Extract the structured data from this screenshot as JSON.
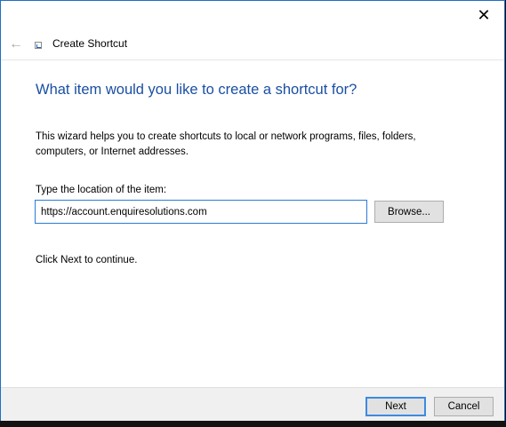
{
  "titlebar": {
    "close_glyph": "✕"
  },
  "nav": {
    "back_glyph": "←",
    "title": "Create Shortcut",
    "icon": "shortcut-wizard-icon"
  },
  "content": {
    "heading": "What item would you like to create a shortcut for?",
    "description": "This wizard helps you to create shortcuts to local or network programs, files, folders, computers, or Internet addresses.",
    "location_label": "Type the location of the item:",
    "location_value": "https://account.enquiresolutions.com",
    "browse_label": "Browse...",
    "hint": "Click Next to continue."
  },
  "footer": {
    "next_label": "Next",
    "cancel_label": "Cancel"
  },
  "colors": {
    "accent": "#1f6fc5",
    "heading": "#1a4fa3",
    "footer_bg": "#f0f0f0"
  }
}
